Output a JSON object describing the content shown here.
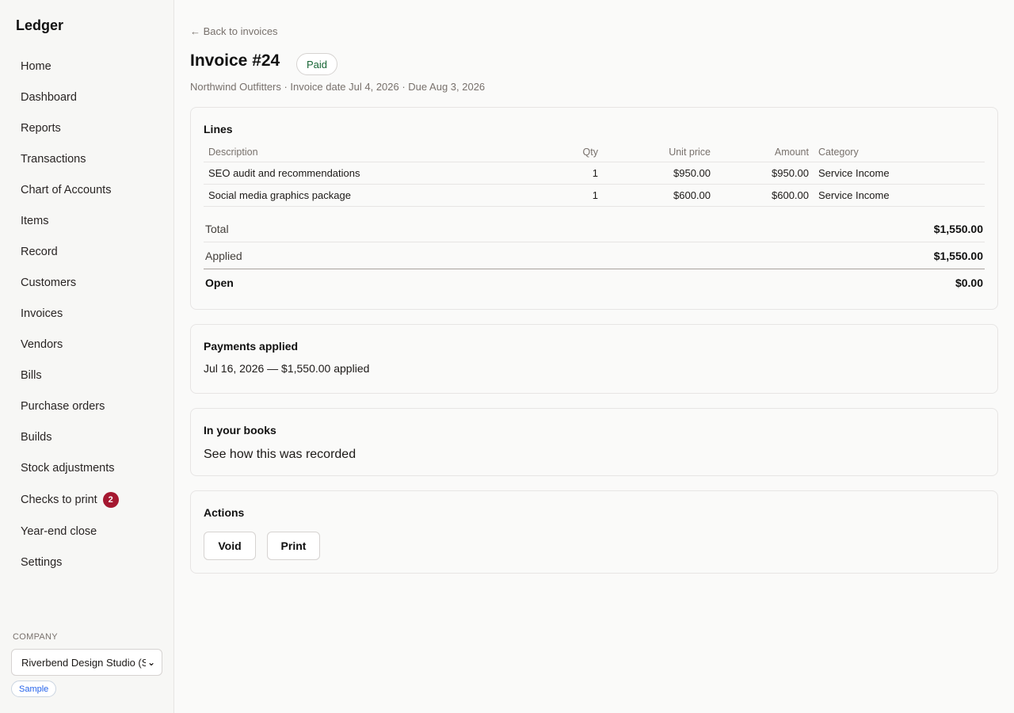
{
  "app": {
    "brand": "Ledger"
  },
  "sidebar": {
    "items": [
      {
        "label": "Home"
      },
      {
        "label": "Dashboard"
      },
      {
        "label": "Reports"
      },
      {
        "label": "Transactions"
      },
      {
        "label": "Chart of Accounts"
      },
      {
        "label": "Items"
      },
      {
        "label": "Record"
      },
      {
        "label": "Customers"
      },
      {
        "label": "Invoices"
      },
      {
        "label": "Vendors"
      },
      {
        "label": "Bills"
      },
      {
        "label": "Purchase orders"
      },
      {
        "label": "Builds"
      },
      {
        "label": "Stock adjustments"
      },
      {
        "label": "Checks to print",
        "badge": "2"
      },
      {
        "label": "Year-end close"
      },
      {
        "label": "Settings"
      }
    ],
    "company_label": "COMPANY",
    "company_selected": "Riverbend Design Studio (S",
    "sample_label": "Sample"
  },
  "header": {
    "back_link": "← Back to invoices",
    "title": "Invoice #24",
    "status": "Paid",
    "subtitle": "Northwind Outfitters · Invoice date Jul 4, 2026 · Due Aug 3, 2026"
  },
  "lines": {
    "title": "Lines",
    "columns": [
      "Description",
      "Qty",
      "Unit price",
      "Amount",
      "Category"
    ],
    "rows": [
      {
        "description": "SEO audit and recommendations",
        "qty": "1",
        "unit_price": "$950.00",
        "amount": "$950.00",
        "category": "Service Income"
      },
      {
        "description": "Social media graphics package",
        "qty": "1",
        "unit_price": "$600.00",
        "amount": "$600.00",
        "category": "Service Income"
      }
    ],
    "totals": {
      "total_label": "Total",
      "total_value": "$1,550.00",
      "applied_label": "Applied",
      "applied_value": "$1,550.00",
      "open_label": "Open",
      "open_value": "$0.00"
    }
  },
  "payments": {
    "title": "Payments applied",
    "entries": [
      "Jul 16, 2026 — $1,550.00 applied"
    ]
  },
  "books": {
    "title": "In your books",
    "link": "See how this was recorded"
  },
  "actions": {
    "title": "Actions",
    "void_label": "Void",
    "print_label": "Print"
  },
  "colors": {
    "badge_red": "#a51830",
    "paid_green": "#166534",
    "sample_blue": "#2563eb"
  }
}
